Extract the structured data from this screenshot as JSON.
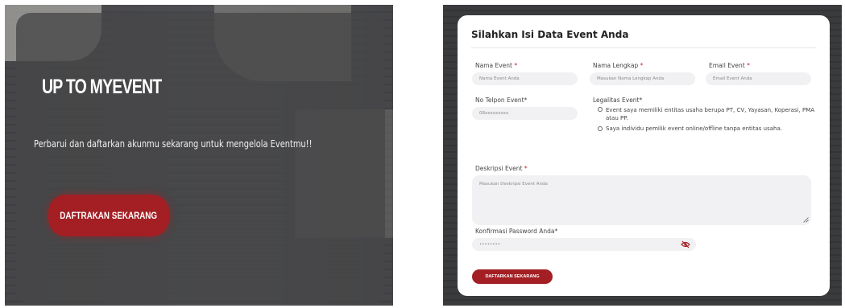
{
  "hero": {
    "title": "UP TO MYEVENT",
    "subtitle": "Perbarui dan daftarkan akunmu sekarang untuk mengelola Eventmu!!",
    "cta_label": "DAFTRAKAN SEKARANG"
  },
  "form": {
    "title": "Silahkan Isi Data Event Anda",
    "fields": {
      "nama_event": {
        "label": "Nama Event",
        "required_mark": "*",
        "placeholder": "Nama Event Anda"
      },
      "nama_lengkap": {
        "label": "Nama Lengkap",
        "required_mark": "*",
        "placeholder": "Masukan Nama Lengkap Anda"
      },
      "email_event": {
        "label": "Email Event",
        "required_mark": "*",
        "placeholder": "Email Event Anda"
      },
      "no_telpon": {
        "label": "No Telpon Event*",
        "placeholder": "08xxxxxxxxx"
      },
      "legalitas": {
        "label": "Legalitas Event*",
        "options": [
          "Event saya memiliki entitas usaha berupa PT, CV, Yayasan, Koperasi, PMA atau PP.",
          "Saya individu pemilik event online/offline tanpa entitas usaha."
        ]
      },
      "deskripsi": {
        "label": "Deskripsi Event",
        "required_mark": "*",
        "placeholder": "Masukan Deskripsi Event Anda"
      },
      "password": {
        "label": "Konfirmasi Password Anda*",
        "value": "••••••••"
      }
    },
    "submit_label": "DAFTARKAN SEKARANG",
    "accent_color": "#a31f24"
  }
}
